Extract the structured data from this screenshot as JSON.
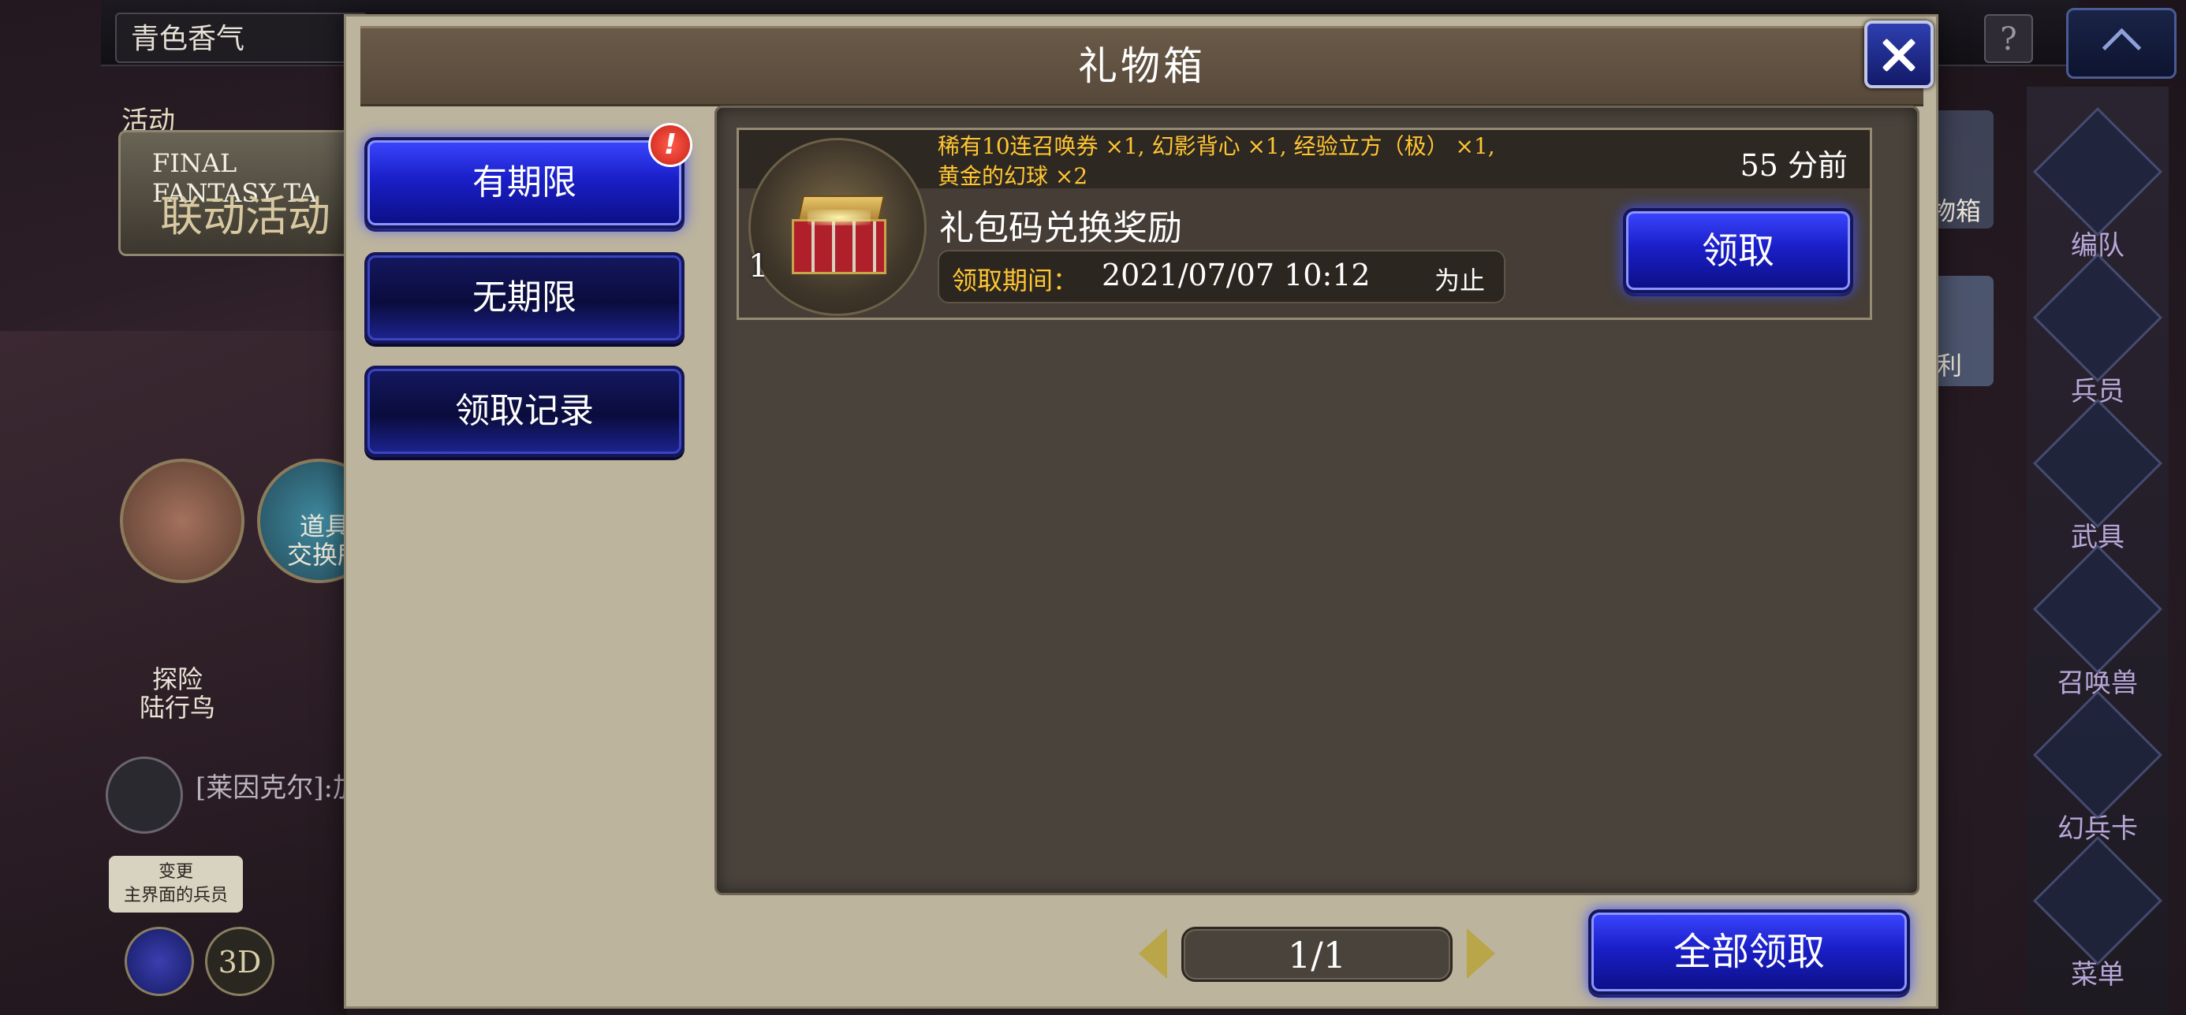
{
  "background": {
    "player_name": "青色香气",
    "help_icon": "?",
    "event_label": "活动",
    "event_banner_line1": "FINAL FANTASY TA",
    "event_banner_line2": "联动活动",
    "shop_label": "道具\n交换所",
    "chocobo_label": "探险\n陆行鸟",
    "chat_text": "[莱因克尔]:加",
    "tooltip": "变更\n主界面的兵员",
    "btn_3d": "3D",
    "side_mid_label_1": "物箱",
    "side_mid_label_2": "利",
    "side_menu": [
      "编队",
      "兵员",
      "武具",
      "召唤兽",
      "幻兵卡",
      "菜单"
    ]
  },
  "modal": {
    "title": "礼物箱",
    "close_icon": "close-icon",
    "tabs": [
      {
        "label": "有期限",
        "active": true,
        "alert": "!"
      },
      {
        "label": "无期限",
        "active": false
      },
      {
        "label": "领取记录",
        "active": false
      }
    ],
    "gifts": [
      {
        "contents": "稀有10连召唤券 ×1, 幻影背心 ×1, 经验立方（极） ×1,\n黄金的幻球 ×2",
        "time_ago": "55 分前",
        "name": "礼包码兑换奖励",
        "count": "1",
        "period_label": "领取期间：",
        "period_value": "2021/07/07 10:12",
        "period_suffix": "为止",
        "claim_label": "领取"
      }
    ],
    "pagination": "1/1",
    "claim_all_label": "全部领取"
  },
  "colors": {
    "accent_blue": "#1a1fc8",
    "gold_text": "#ffc632",
    "panel_bg": "#4a433c",
    "modal_bg": "#bcb49d",
    "alert_red": "#e0302a"
  }
}
